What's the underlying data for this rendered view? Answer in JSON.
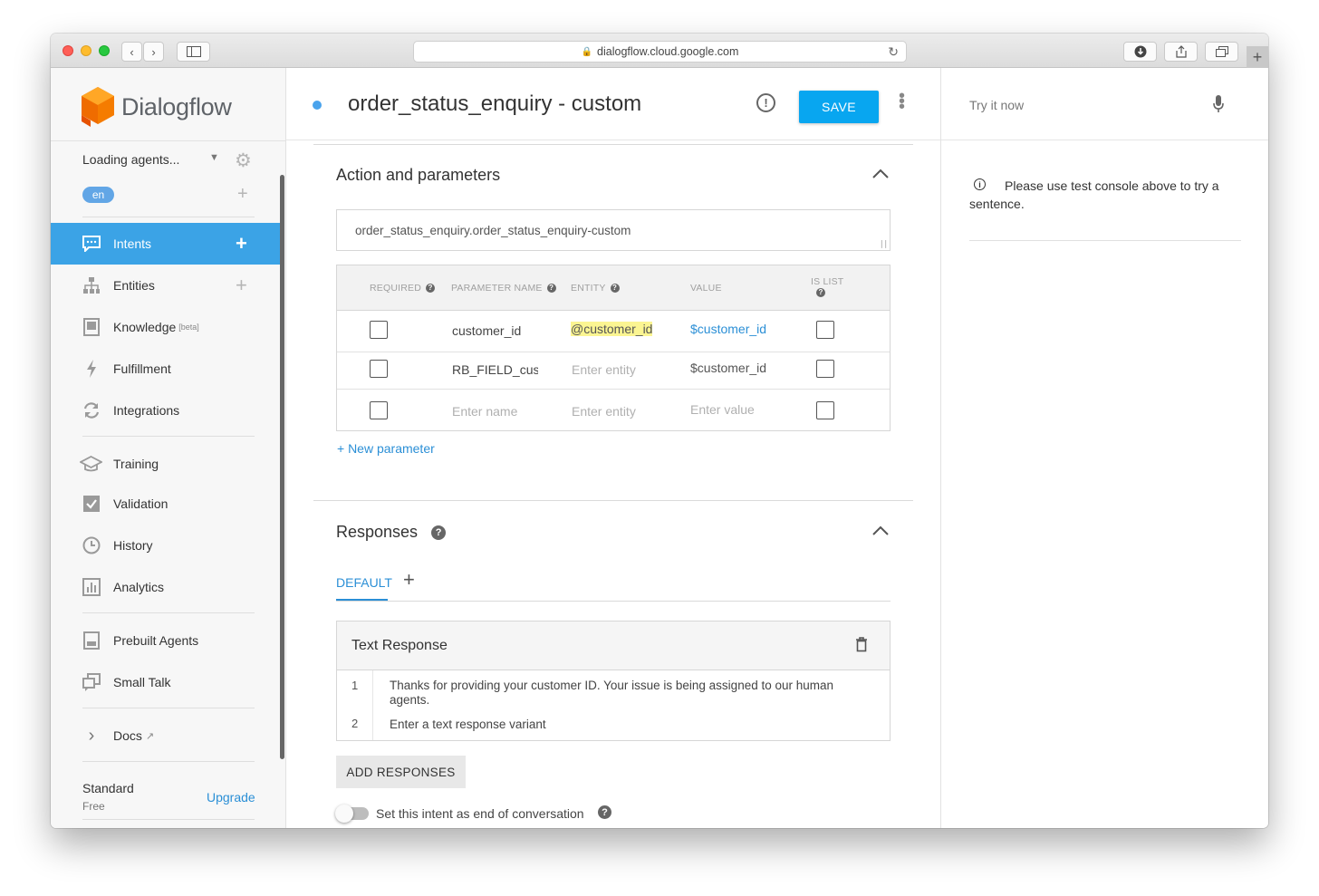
{
  "browser": {
    "url": "dialogflow.cloud.google.com"
  },
  "sidebar": {
    "brand": "Dialogflow",
    "agent_label": "Loading agents...",
    "language": "en",
    "items": [
      {
        "label": "Intents",
        "icon": "chat-bubble-icon",
        "active": true,
        "plus": true
      },
      {
        "label": "Entities",
        "icon": "hierarchy-icon",
        "plus": true
      },
      {
        "label": "Knowledge",
        "icon": "book-icon",
        "badge": "[beta]"
      },
      {
        "label": "Fulfillment",
        "icon": "bolt-icon"
      },
      {
        "label": "Integrations",
        "icon": "sync-icon"
      },
      {
        "label": "Training",
        "icon": "graduation-cap-icon"
      },
      {
        "label": "Validation",
        "icon": "checkbox-icon"
      },
      {
        "label": "History",
        "icon": "clock-icon"
      },
      {
        "label": "Analytics",
        "icon": "bar-chart-icon"
      },
      {
        "label": "Prebuilt Agents",
        "icon": "prebuilt-icon"
      },
      {
        "label": "Small Talk",
        "icon": "small-talk-icon"
      },
      {
        "label": "Docs",
        "icon": "chevron-right-icon"
      }
    ],
    "plan": "Standard",
    "plan_sub": "Free",
    "upgrade": "Upgrade",
    "accent": "#3ba3e6"
  },
  "header": {
    "intent_title": "order_status_enquiry - custom",
    "save_label": "SAVE"
  },
  "action": {
    "section_title": "Action and parameters",
    "action_name": "order_status_enquiry.order_status_enquiry-custom",
    "columns": {
      "required": "REQUIRED",
      "name": "PARAMETER NAME",
      "entity": "ENTITY",
      "value": "VALUE",
      "is_list": "IS LIST"
    },
    "rows": [
      {
        "name": "customer_id",
        "entity": "@customer_id",
        "value": "$customer_id"
      },
      {
        "name": "RB_FIELD_custo",
        "entity_placeholder": "Enter entity",
        "value": "$customer_id"
      },
      {
        "name_placeholder": "Enter name",
        "entity_placeholder": "Enter entity",
        "value_placeholder": "Enter value"
      }
    ],
    "new_parameter": "+ New parameter"
  },
  "responses": {
    "section_title": "Responses",
    "tab_default": "DEFAULT",
    "text_response_title": "Text Response",
    "lines": [
      {
        "num": "1",
        "text": "Thanks for providing your customer ID. Your issue is being assigned to our human agents."
      },
      {
        "num": "2",
        "placeholder": "Enter a text response variant"
      }
    ],
    "add_responses": "ADD RESPONSES",
    "end_conversation_label": "Set this intent as end of conversation"
  },
  "test_console": {
    "try_label": "Try it now",
    "note": "Please use test console above to try a sentence."
  },
  "colors": {
    "save_button": "#08a6f0",
    "link": "#2b8fd6",
    "highlight": "#fbf592"
  }
}
